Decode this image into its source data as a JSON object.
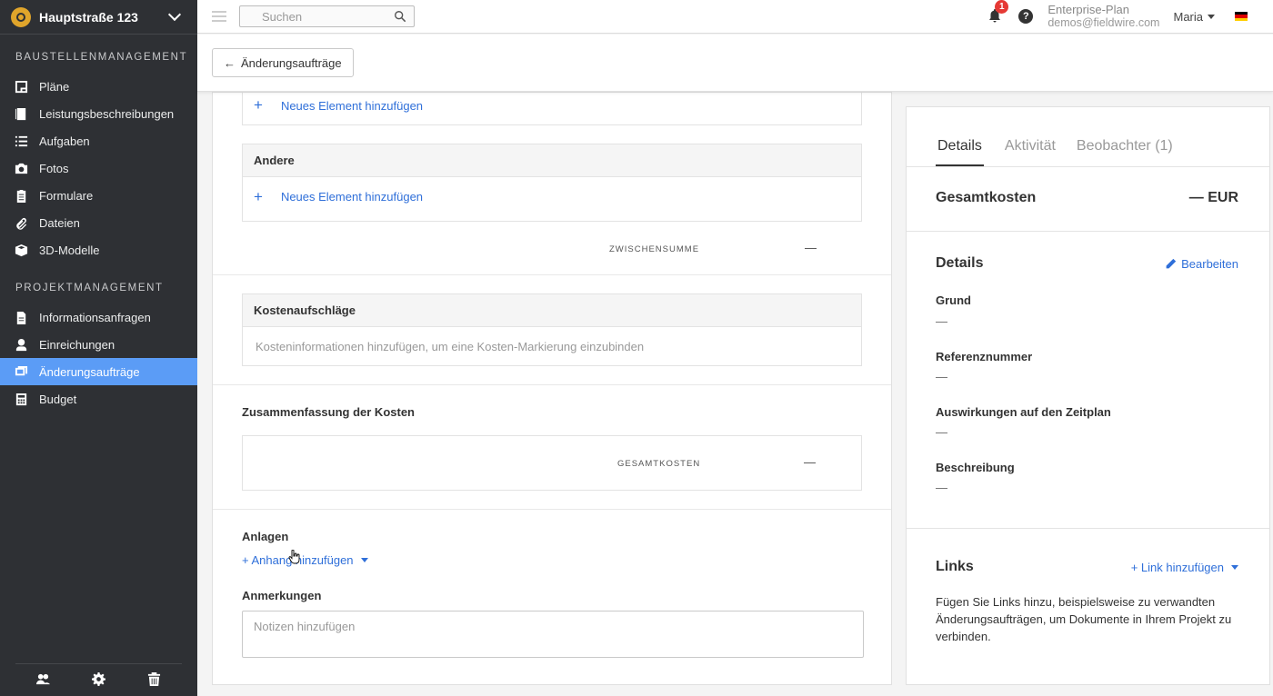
{
  "project": {
    "name": "Hauptstraße 123"
  },
  "sidebar": {
    "section1_title": "BAUSTELLENMANAGEMENT",
    "section1_items": [
      {
        "label": "Pläne",
        "icon": "plans-icon"
      },
      {
        "label": "Leistungsbeschreibungen",
        "icon": "specs-icon"
      },
      {
        "label": "Aufgaben",
        "icon": "tasks-icon"
      },
      {
        "label": "Fotos",
        "icon": "camera-icon"
      },
      {
        "label": "Formulare",
        "icon": "forms-icon"
      },
      {
        "label": "Dateien",
        "icon": "paperclip-icon"
      },
      {
        "label": "3D-Modelle",
        "icon": "cube-icon"
      }
    ],
    "section2_title": "PROJEKTMANAGEMENT",
    "section2_items": [
      {
        "label": "Informationsanfragen",
        "icon": "rfi-icon"
      },
      {
        "label": "Einreichungen",
        "icon": "submittals-icon"
      },
      {
        "label": "Änderungsaufträge",
        "icon": "change-orders-icon",
        "active": true
      },
      {
        "label": "Budget",
        "icon": "calculator-icon"
      }
    ],
    "active_color": "#5b9cf6"
  },
  "topbar": {
    "search_placeholder": "Suchen",
    "notification_count": "1",
    "help": "?",
    "plan": "Enterprise-Plan",
    "email": "demos@fieldwire.com",
    "user": "Maria"
  },
  "subheader": {
    "back_label": "Änderungsaufträge"
  },
  "main": {
    "add_item_label_top": "Neues Element hinzufügen",
    "other_section_title": "Andere",
    "add_item_label_other": "Neues Element hinzufügen",
    "subtotal_label": "ZWISCHENSUMME",
    "subtotal_value": "—",
    "markups_title": "Kostenaufschläge",
    "markups_placeholder": "Kosteninformationen hinzufügen, um eine Kosten-Markierung einzubinden",
    "summary_title": "Zusammenfassung der Kosten",
    "total_label": "GESAMTKOSTEN",
    "total_value": "—",
    "attachments_title": "Anlagen",
    "add_attachment_label": "+ Anhang hinzufügen",
    "notes_title": "Anmerkungen",
    "notes_placeholder": "Notizen hinzufügen"
  },
  "right_panel": {
    "tabs": [
      "Details",
      "Aktivität",
      "Beobachter (1)"
    ],
    "total_cost_label": "Gesamtkosten",
    "total_cost_value": "— EUR",
    "details_title": "Details",
    "edit_label": "Bearbeiten",
    "fields": [
      {
        "label": "Grund",
        "value": "—"
      },
      {
        "label": "Referenznummer",
        "value": "—"
      },
      {
        "label": "Auswirkungen auf den Zeitplan",
        "value": "—"
      },
      {
        "label": "Beschreibung",
        "value": "—"
      }
    ],
    "links_title": "Links",
    "add_link_label": "+ Link hinzufügen",
    "links_description": "Fügen Sie Links hinzu, beispielsweise zu verwandten Änderungsaufträgen, um Dokumente in Ihrem Projekt zu verbinden."
  },
  "colors": {
    "link": "#2f6fd9",
    "sidebar_bg": "#2e3034",
    "badge": "#e53935"
  }
}
